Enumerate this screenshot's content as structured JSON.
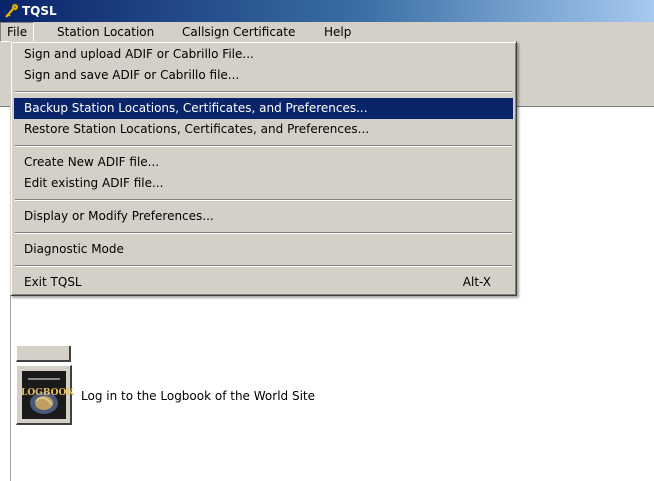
{
  "window": {
    "title": "TQSL"
  },
  "menubar": {
    "items": [
      {
        "label": "File"
      },
      {
        "label": "Station Location"
      },
      {
        "label": "Callsign Certificate"
      },
      {
        "label": "Help"
      }
    ]
  },
  "file_menu": {
    "sign_upload": "Sign and upload ADIF or Cabrillo File...",
    "sign_save": "Sign and save ADIF or Cabrillo file...",
    "backup": "Backup Station Locations, Certificates, and Preferences...",
    "restore": "Restore Station Locations, Certificates, and Preferences...",
    "create_adif": "Create New ADIF file...",
    "edit_adif": "Edit existing ADIF file...",
    "preferences": "Display or Modify Preferences...",
    "diagnostic": "Diagnostic Mode",
    "exit": "Exit TQSL",
    "exit_shortcut": "Alt-X"
  },
  "main": {
    "lotw_label": "Log in to the Logbook of the World Site",
    "lotw_logo_text": "LOGBOOK"
  },
  "colors": {
    "highlight": "#0a246a",
    "menu_face": "#d4d0c8",
    "title_gradient_end": "#a6caf0"
  }
}
